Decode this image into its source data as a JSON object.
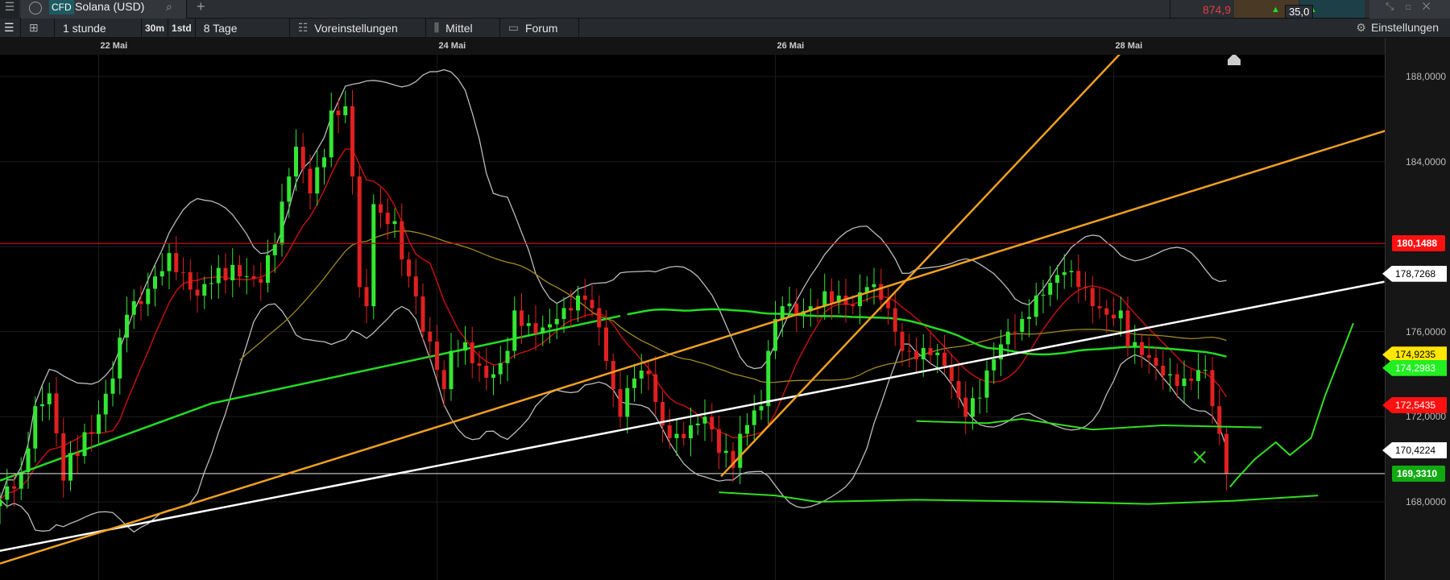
{
  "topbar": {
    "cfd_badge": "CFD",
    "instrument": "Solana (USD)",
    "add": "+",
    "change_value": "874,9",
    "spread": "35,0"
  },
  "toolbar": {
    "interval": "1 stunde",
    "btn_30m": "30m",
    "btn_1std": "1std",
    "range": "8 Tage",
    "presets": "Voreinstellungen",
    "indicator": "Mittel",
    "forum": "Forum",
    "settings": "Einstellungen"
  },
  "colors": {
    "up": "#33e633",
    "down": "#e02020",
    "sma_fast": "#c01010",
    "sma_mid": "#a08a20",
    "sma_slow": "#22dd22",
    "bands": "#bbbbbb",
    "trend_orange": "#f0a020",
    "trend_white": "#ffffff",
    "support": "#33dd22"
  },
  "chart_data": {
    "type": "candlestick",
    "instrument": "Solana (USD)",
    "interval": "1 hour",
    "x_unit": "hours since chart start (21 Mai ~10:00)",
    "date_labels": [
      {
        "t": 14,
        "label": "22 Mai"
      },
      {
        "t": 62,
        "label": "24 Mai"
      },
      {
        "t": 110,
        "label": "26 Mai"
      },
      {
        "t": 158,
        "label": "28 Mai"
      }
    ],
    "y_ticks": [
      "188,0000",
      "184,0000",
      "176,0000",
      "172,0000",
      "168,0000"
    ],
    "y_tick_values": [
      188,
      184,
      176,
      172,
      168
    ],
    "ylim": [
      162.3,
      189.1
    ],
    "close_path": [
      [
        0,
        168.1
      ],
      [
        3,
        169.4
      ],
      [
        5,
        172.5
      ],
      [
        7,
        173.1
      ],
      [
        9,
        169
      ],
      [
        10,
        170.3
      ],
      [
        13,
        171.2
      ],
      [
        16,
        173.8
      ],
      [
        18,
        176.8
      ],
      [
        20,
        177.3
      ],
      [
        22,
        178.6
      ],
      [
        24,
        179.7
      ],
      [
        26,
        178.8
      ],
      [
        28,
        177.7
      ],
      [
        31,
        179
      ],
      [
        34,
        178.6
      ],
      [
        37,
        178.3
      ],
      [
        39,
        180.1
      ],
      [
        41,
        183.3
      ],
      [
        42,
        184.7
      ],
      [
        44,
        182.5
      ],
      [
        46,
        184.2
      ],
      [
        47,
        186.4
      ],
      [
        49,
        186.6
      ],
      [
        50,
        183.3
      ],
      [
        51,
        178.1
      ],
      [
        52,
        177.2
      ],
      [
        53,
        182
      ],
      [
        54,
        181.6
      ],
      [
        56,
        181.2
      ],
      [
        57,
        179.4
      ],
      [
        58,
        178.6
      ],
      [
        60,
        176
      ],
      [
        62,
        174.2
      ],
      [
        63,
        173.3
      ],
      [
        64,
        175.1
      ],
      [
        66,
        175.5
      ],
      [
        68,
        174.4
      ],
      [
        70,
        174
      ],
      [
        72,
        175.1
      ],
      [
        73,
        177
      ],
      [
        75,
        176.4
      ],
      [
        77,
        176.2
      ],
      [
        79,
        176.6
      ],
      [
        81,
        177
      ],
      [
        83,
        177.5
      ],
      [
        85,
        176.2
      ],
      [
        87,
        173.3
      ],
      [
        88,
        172
      ],
      [
        90,
        173.8
      ],
      [
        92,
        174
      ],
      [
        94,
        171.6
      ],
      [
        96,
        171.2
      ],
      [
        98,
        171.6
      ],
      [
        100,
        172
      ],
      [
        102,
        170.3
      ],
      [
        104,
        169.6
      ],
      [
        105,
        171.2
      ],
      [
        107,
        172.3
      ],
      [
        108,
        172.5
      ],
      [
        109,
        175.1
      ],
      [
        111,
        177.2
      ],
      [
        113,
        176.8
      ],
      [
        115,
        177.2
      ],
      [
        117,
        177.9
      ],
      [
        119,
        177.7
      ],
      [
        121,
        177.2
      ],
      [
        123,
        178.1
      ],
      [
        125,
        177.5
      ],
      [
        127,
        176
      ],
      [
        128,
        175.1
      ],
      [
        130,
        174.7
      ],
      [
        132,
        174.9
      ],
      [
        134,
        174.4
      ],
      [
        136,
        172.9
      ],
      [
        137,
        172
      ],
      [
        139,
        172.9
      ],
      [
        141,
        174.7
      ],
      [
        143,
        176
      ],
      [
        145,
        176.6
      ],
      [
        147,
        177.7
      ],
      [
        149,
        178.3
      ],
      [
        151,
        178.8
      ],
      [
        153,
        178.1
      ],
      [
        155,
        177.2
      ],
      [
        157,
        176.8
      ],
      [
        159,
        177
      ],
      [
        160,
        175.3
      ],
      [
        162,
        174.9
      ],
      [
        164,
        174.4
      ],
      [
        166,
        174
      ],
      [
        168,
        173.8
      ],
      [
        170,
        174.2
      ],
      [
        171,
        174.2
      ],
      [
        172,
        172.5
      ],
      [
        173,
        171.2
      ],
      [
        174,
        169.331
      ]
    ],
    "lines": [
      {
        "name": "trend-white",
        "from": [
          0,
          165.7
        ],
        "to": [
          196.4,
          178.35
        ],
        "color": "#ffffff"
      },
      {
        "name": "trend-orange-long",
        "from": [
          0,
          165.1
        ],
        "to": [
          205.7,
          186.4
        ],
        "color": "#f0a020"
      },
      {
        "name": "trend-orange-steep",
        "from": [
          102.3,
          169.2
        ],
        "to": [
          159,
          189.1
        ],
        "color": "#f0a020"
      }
    ],
    "hlines": [
      {
        "price": 180.1488,
        "color": "#c01010"
      },
      {
        "price": 169.331,
        "color": "#bbbbbb"
      }
    ],
    "drawn": [
      {
        "name": "support-lower",
        "points": [
          [
            102,
            168.45
          ],
          [
            110,
            168.3
          ],
          [
            116,
            168.0
          ],
          [
            130,
            168.1
          ],
          [
            150,
            168.0
          ],
          [
            163,
            167.9
          ],
          [
            175,
            168.05
          ],
          [
            187,
            168.3
          ]
        ]
      },
      {
        "name": "support-upper",
        "points": [
          [
            130,
            171.8
          ],
          [
            140,
            171.7
          ],
          [
            145,
            171.9
          ],
          [
            155,
            171.4
          ],
          [
            165,
            171.6
          ],
          [
            179,
            171.5
          ]
        ]
      },
      {
        "name": "forecast-arrow",
        "points": [
          [
            174.5,
            168.7
          ],
          [
            175.5,
            169.1
          ],
          [
            178,
            170
          ],
          [
            181,
            170.8
          ],
          [
            183,
            170.2
          ],
          [
            186,
            171
          ],
          [
            188,
            173
          ],
          [
            192,
            176.4
          ]
        ]
      }
    ],
    "price_tags": [
      {
        "value": "180,1488",
        "price": 180.1488,
        "bg": "#ff1010",
        "fg": "#ffffff"
      },
      {
        "value": "178,7268",
        "price": 178.7268,
        "bg": "#ffffff",
        "fg": "#000000"
      },
      {
        "value": "174,9235",
        "price": 174.9235,
        "bg": "#ffe600",
        "fg": "#000000"
      },
      {
        "value": "174,2983",
        "price": 174.2983,
        "bg": "#22ee22",
        "fg": "#ffffff"
      },
      {
        "value": "172,5435",
        "price": 172.5435,
        "bg": "#ff1010",
        "fg": "#ffffff"
      },
      {
        "value": "170,4224",
        "price": 170.4224,
        "bg": "#ffffff",
        "fg": "#000000"
      },
      {
        "value": "169,3310",
        "price": 169.331,
        "bg": "#11aa11",
        "fg": "#ffffff"
      }
    ]
  }
}
